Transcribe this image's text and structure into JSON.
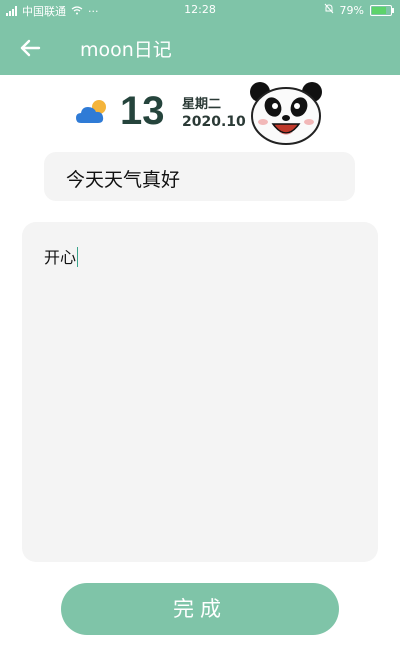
{
  "status_bar": {
    "carrier": "中国联通",
    "time": "12:28",
    "battery": "79%",
    "battery_level": 0.79
  },
  "app_bar": {
    "title": "moon日记",
    "back_icon": "arrow-left-icon"
  },
  "date": {
    "day": "13",
    "weekday": "星期二",
    "year_month": "2020.10",
    "weather_icon": "partly-cloudy-icon"
  },
  "title_field": {
    "value": "今天天气真好"
  },
  "content_field": {
    "value": "开心"
  },
  "done_button": {
    "label": "完成"
  },
  "colors": {
    "accent": "#7fc4a8",
    "field_bg": "#f4f4f4",
    "cloud": "#2f7bd6",
    "sun": "#f4b43a"
  }
}
